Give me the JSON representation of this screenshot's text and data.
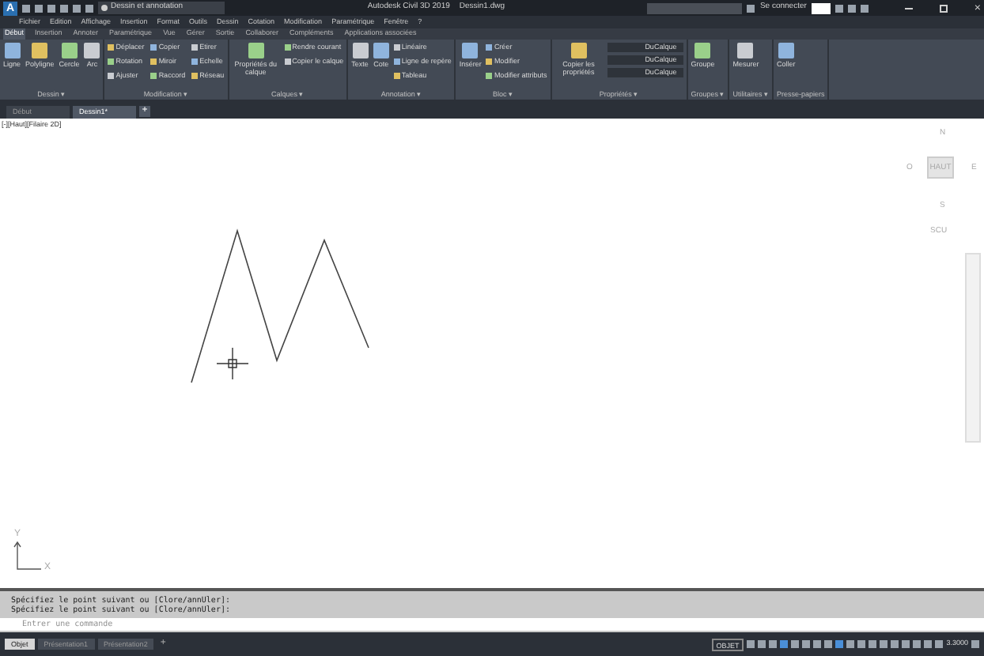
{
  "window": {
    "logo": "A",
    "title": "Autodesk Civil 3D 2019",
    "document": "Dessin1.dwg",
    "workspace": "Dessin et annotation",
    "sign_in": "Se connecter",
    "close": "×"
  },
  "menu": [
    "Fichier",
    "Edition",
    "Affichage",
    "Insertion",
    "Format",
    "Outils",
    "Dessin",
    "Cotation",
    "Modification",
    "Paramétrique",
    "Fenêtre",
    "?"
  ],
  "ribbon_tabs": [
    {
      "label": "Début",
      "selected": true
    },
    {
      "label": "Insertion",
      "selected": false
    },
    {
      "label": "Annoter",
      "selected": false
    },
    {
      "label": "Paramétrique",
      "selected": false
    },
    {
      "label": "Vue",
      "selected": false
    },
    {
      "label": "Gérer",
      "selected": false
    },
    {
      "label": "Sortie",
      "selected": false
    },
    {
      "label": "Collaborer",
      "selected": false
    },
    {
      "label": "Compléments",
      "selected": false
    },
    {
      "label": "Applications associées",
      "selected": false
    }
  ],
  "panels": [
    {
      "title": "Dessin ▾",
      "large": [
        "Ligne",
        "Polyligne",
        "Cercle",
        "Arc"
      ]
    },
    {
      "title": "Modification ▾",
      "small": [
        "Déplacer",
        "Rotation",
        "Ajuster",
        "Copier",
        "Miroir",
        "Raccord",
        "Etirer",
        "Echelle",
        "Réseau"
      ]
    },
    {
      "title": "Calques ▾",
      "large": [
        "Propriétés du calque"
      ],
      "small": [
        "Rendre courant",
        "Copier le calque"
      ]
    },
    {
      "title": "Annotation ▾",
      "large": [
        "Texte",
        "Cote"
      ],
      "small": [
        "Linéaire",
        "Ligne de repère",
        "Tableau"
      ]
    },
    {
      "title": "Bloc ▾",
      "large": [
        "Insérer"
      ],
      "small": [
        "Créer",
        "Modifier",
        "Modifier attributs"
      ]
    },
    {
      "title": "Propriétés ▾",
      "large": [
        "Copier les propriétés"
      ],
      "small": [
        "DuCalque",
        "DuCalque",
        "DuCalque"
      ],
      "kind": "dropdowns"
    },
    {
      "title": "Groupes ▾",
      "large": [
        "Groupe"
      ]
    },
    {
      "title": "Utilitaires ▾",
      "large": [
        "Mesurer"
      ]
    },
    {
      "title": "Presse-papiers",
      "large": [
        "Coller"
      ]
    }
  ],
  "doc_tabs": [
    {
      "label": "Début",
      "selected": false
    },
    {
      "label": "Dessin1*",
      "selected": true
    }
  ],
  "new_tab": "+",
  "viewport": {
    "label": "[-][Haut][Filaire 2D]",
    "viewcube": {
      "north": "N",
      "west": "O",
      "east": "E",
      "south": "S",
      "face": "HAUT",
      "ucs": "SCU"
    },
    "axis_x": "X",
    "axis_y": "Y"
  },
  "command": {
    "history": [
      "Spécifiez le point suivant ou [Clore/annUler]:",
      "Spécifiez le point suivant ou [Clore/annUler]:"
    ],
    "placeholder": "Entrer une commande"
  },
  "layout_tabs": [
    {
      "label": "Objet",
      "selected": true
    },
    {
      "label": "Présentation1",
      "selected": false
    },
    {
      "label": "Présentation2",
      "selected": false
    }
  ],
  "new_layout": "+",
  "status": {
    "mode": "OBJET",
    "scale": "3.3000"
  }
}
